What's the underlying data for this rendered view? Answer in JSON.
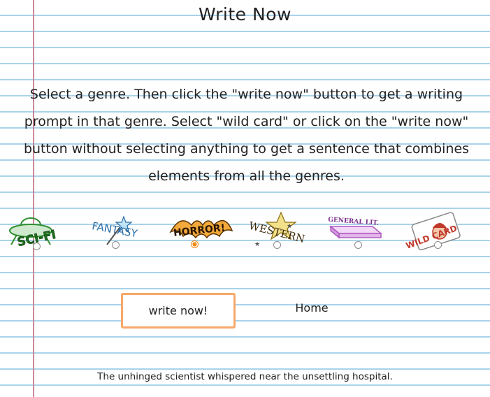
{
  "page": {
    "title": "Write Now",
    "intro": "Select a genre. Then click the \"write now\" button to get a writing prompt in that genre. Select \"wild card\" or click on the \"write now\" button without selecting anything to get a sentence that combines elements from all the genres."
  },
  "genres": [
    {
      "label": "SCI-FI",
      "icon": "ufo-icon",
      "color": "#2f8f2f",
      "selected": false
    },
    {
      "label": "FANTASY",
      "icon": "magic-wand-icon",
      "color": "#2e6ea6",
      "selected": false
    },
    {
      "label": "HORROR!",
      "icon": "bat-icon",
      "color": "#e08a1e",
      "selected": true
    },
    {
      "label": "WESTERN",
      "icon": "sheriff-star-icon",
      "color": "#c9a227",
      "selected": false
    },
    {
      "label": "GENERAL LIT.",
      "icon": "book-icon",
      "color": "#b05ac0",
      "selected": false
    },
    {
      "label": "WILD CARD",
      "icon": "joker-card-icon",
      "color": "#c0392b",
      "selected": false
    }
  ],
  "actions": {
    "write_now_label": "write now!",
    "home_label": "Home"
  },
  "prompt_text": "The unhinged scientist whispered near the unsettling hospital.",
  "colors": {
    "ruled_line": "#a9d3ea",
    "margin_line": "#c98a98",
    "button_border": "#f7a86a",
    "radio_selected": "#f0891a"
  }
}
